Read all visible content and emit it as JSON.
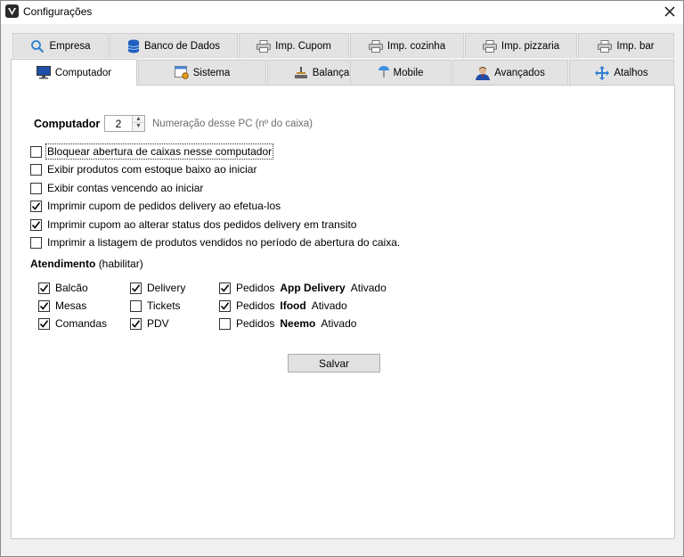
{
  "window": {
    "title": "Configurações"
  },
  "tabs_row1": [
    {
      "label": "Empresa",
      "icon": "search-icon"
    },
    {
      "label": "Banco de Dados",
      "icon": "database-icon"
    },
    {
      "label": "Imp. Cupom",
      "icon": "printer-icon"
    },
    {
      "label": "Imp. cozinha",
      "icon": "printer-icon"
    },
    {
      "label": "Imp. pizzaria",
      "icon": "printer-icon"
    },
    {
      "label": "Imp. bar",
      "icon": "printer-icon"
    }
  ],
  "tabs_row2": [
    {
      "label": "Computador",
      "icon": "monitor-icon",
      "active": true
    },
    {
      "label": "Sistema",
      "icon": "system-icon"
    },
    {
      "label": "Balança",
      "icon": "scale-icon"
    },
    {
      "label": "Mobile",
      "icon": "mobile-icon"
    },
    {
      "label": "Avançados",
      "icon": "user-icon"
    },
    {
      "label": "Atalhos",
      "icon": "arrows-icon"
    }
  ],
  "computador": {
    "label": "Computador",
    "value": "2",
    "hint": "Numeração desse PC (nº do caixa)"
  },
  "options": [
    {
      "label": "Bloquear abertura de caixas nesse computador",
      "checked": false
    },
    {
      "label": "Exibir produtos com estoque baixo ao iniciar",
      "checked": false
    },
    {
      "label": "Exibir contas vencendo ao iniciar",
      "checked": false
    },
    {
      "label": "Imprimir cupom de pedidos delivery ao efetua-los",
      "checked": true
    },
    {
      "label": "Imprimir cupom ao alterar status dos pedidos delivery em transito",
      "checked": true
    },
    {
      "label": "Imprimir a listagem de produtos vendidos no período de abertura do caixa.",
      "checked": false
    }
  ],
  "atendimento": {
    "title": "Atendimento",
    "subtitle": "(habilitar)",
    "col1": [
      {
        "label": "Balcão",
        "checked": true
      },
      {
        "label": "Mesas",
        "checked": true
      },
      {
        "label": "Comandas",
        "checked": true
      }
    ],
    "col2": [
      {
        "label": "Delivery",
        "checked": true
      },
      {
        "label": "Tickets",
        "checked": false
      },
      {
        "label": "PDV",
        "checked": true
      }
    ],
    "col3": [
      {
        "prefix": "Pedidos",
        "name": "App Delivery",
        "status": "Ativado",
        "checked": true
      },
      {
        "prefix": "Pedidos",
        "name": "Ifood",
        "status": "Ativado",
        "checked": true
      },
      {
        "prefix": "Pedidos",
        "name": "Neemo",
        "status": "Ativado",
        "checked": false
      }
    ]
  },
  "save_label": "Salvar",
  "colors": {
    "panel": "#ffffff",
    "window": "#f0f0f0",
    "tab": "#e3e3e3"
  }
}
